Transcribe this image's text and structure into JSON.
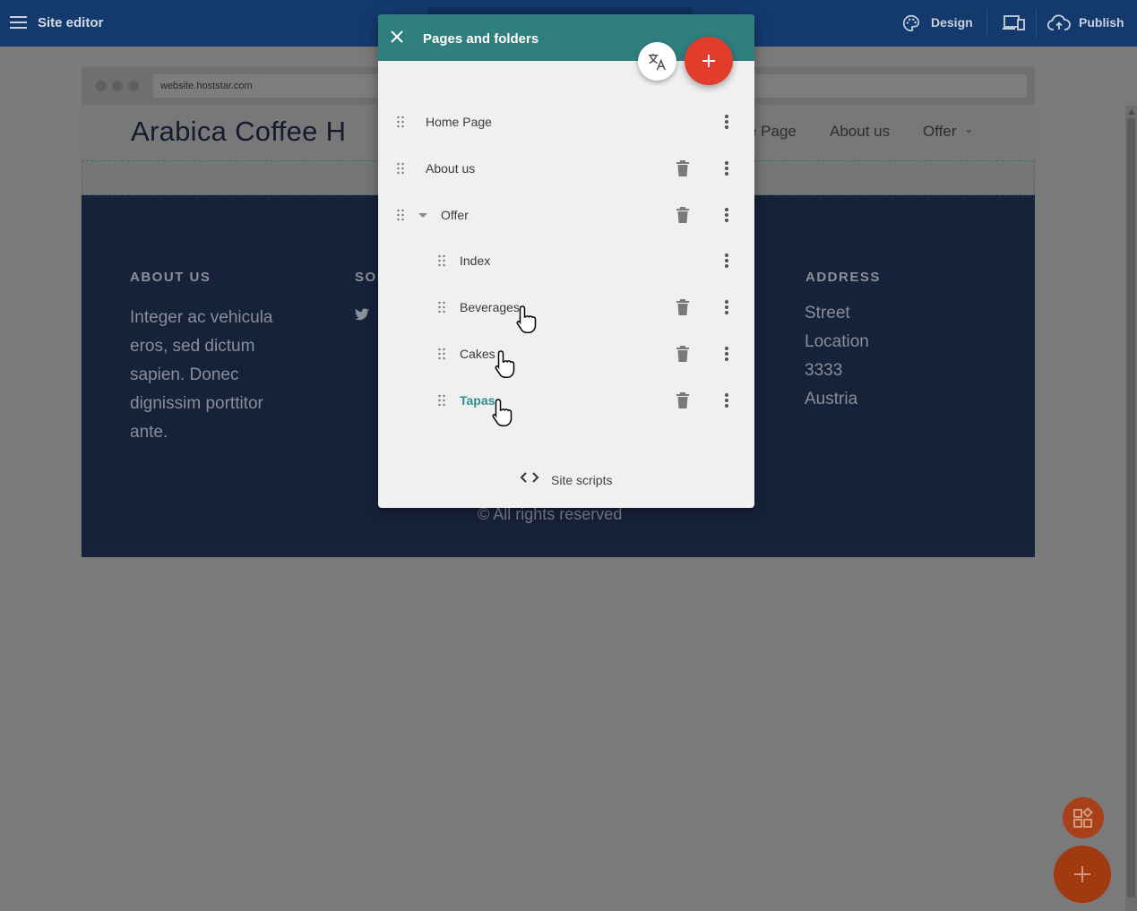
{
  "topbar": {
    "title": "Site editor",
    "design_label": "Design",
    "publish_label": "Publish",
    "menu_icon": "hamburger-icon",
    "design_icon": "palette-icon",
    "devices_icon": "devices-icon",
    "publish_icon": "cloud-upload-icon"
  },
  "preview": {
    "url": "website.hoststar.com",
    "logo": "Arabica Coffee H",
    "nav": {
      "home": "e Page",
      "about": "About us",
      "offer": "Offer",
      "offer_chevron": "⌄"
    },
    "footer": {
      "about_heading": "ABOUT US",
      "about_text": [
        "Integer ac vehicula",
        "eros, sed dictum",
        "sapien. Donec",
        "dignissim porttitor",
        "ante."
      ],
      "social_heading": "SO",
      "address_heading": "ADDRESS",
      "address_lines": [
        "Street",
        "Location",
        "3333",
        "Austria"
      ],
      "copyright": "© All rights reserved"
    }
  },
  "panel": {
    "title": "Pages and folders",
    "pages": [
      {
        "label": "Home Page",
        "deletable": false
      },
      {
        "label": "About us",
        "deletable": true
      },
      {
        "label": "Offer",
        "deletable": true,
        "folder": true
      },
      {
        "label": "Index",
        "deletable": false
      },
      {
        "label": "Beverages",
        "deletable": true
      },
      {
        "label": "Cakes",
        "deletable": true
      },
      {
        "label": "Tapas",
        "deletable": true,
        "active": true
      }
    ],
    "site_scripts_label": "Site scripts",
    "site_scripts_icon": "<>"
  },
  "colors": {
    "topbar": "#143a6d",
    "panel_header": "#2f7f7f",
    "accent_active": "#2f8f8f",
    "fab_red": "#e43c2c",
    "footer_bg": "#16213a"
  }
}
